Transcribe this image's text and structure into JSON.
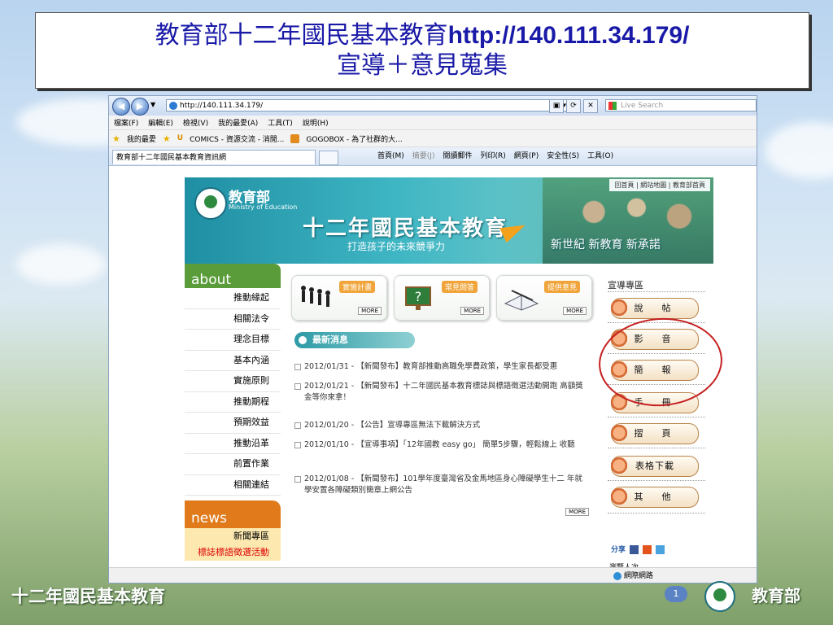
{
  "slide": {
    "title_line1_text": "教育部十二年國民基本教育",
    "title_line1_url": "http://140.111.34.179/",
    "title_line2": "宣導＋意見蒐集",
    "footer_left": "十二年國民基本教育",
    "page_number": "1",
    "footer_right": "教育部"
  },
  "browser": {
    "address": "http://140.111.34.179/",
    "search_placeholder": "Live Search",
    "menu": [
      "檔案(F)",
      "編輯(E)",
      "檢視(V)",
      "我的最愛(A)",
      "工具(T)",
      "說明(H)"
    ],
    "favorites_label": "我的最愛",
    "favorites_links": [
      "COMICS - 資源交流 - 消閒...",
      "GOGOBOX - 為了社群的大..."
    ],
    "tab_title": "教育部十二年國民基本教育資訊網",
    "commands": [
      "首頁(M)",
      "摘要(J)",
      "閱讀郵件",
      "列印(R)",
      "網頁(P)",
      "安全性(S)",
      "工具(O)"
    ],
    "status_zone": "網際網路"
  },
  "site": {
    "moe_name": "教育部",
    "moe_english": "Ministry of Education",
    "banner_title": "十二年國民基本教育",
    "banner_subtitle": "打造孩子的未來競爭力",
    "banner_slogan": "新世紀 新教育 新承諾",
    "top_links": "回首頁 | 網站地圖 | 教育部首頁",
    "about_label": "about",
    "about_items": [
      "推動緣起",
      "相關法令",
      "理念目標",
      "基本內涵",
      "實施原則",
      "推動期程",
      "預期效益",
      "推動沿革",
      "前置作業",
      "相關連結"
    ],
    "news_label": "news",
    "news_items": [
      "新聞專區",
      "標誌標語徵選活動"
    ],
    "cards": [
      {
        "label": "實施計畫",
        "more": "MORE"
      },
      {
        "label": "常見問答",
        "more": "MORE"
      },
      {
        "label": "提供意見",
        "more": "MORE"
      }
    ],
    "latest_header": "最新消息",
    "latest_news": [
      "2012/01/31 - 【新聞發布】教育部推動高職免學費政策，學生家長都受惠",
      "2012/01/21 - 【新聞發布】十二年國民基本教育標誌與標語徵選活動開跑 高額獎金等你來拿！",
      "2012/01/20 - 【公告】宣導專區無法下載解決方式",
      "2012/01/10 - 【宣導事項】「12年國教 easy go」 簡單5步驟，輕鬆線上 收聽",
      "2012/01/08 - 【新聞發布】101學年度臺灣省及金馬地區身心障礙學生十二 年就學安置各障礙類別簡章上網公告"
    ],
    "more_news": "MORE",
    "promo_title": "宣導專區",
    "promo_buttons": [
      "說　帖",
      "影　音",
      "簡　報",
      "手　冊",
      "摺　頁",
      "表格下載",
      "其　他"
    ],
    "share_label": "分享",
    "visits_label": "瀏覽人次"
  }
}
